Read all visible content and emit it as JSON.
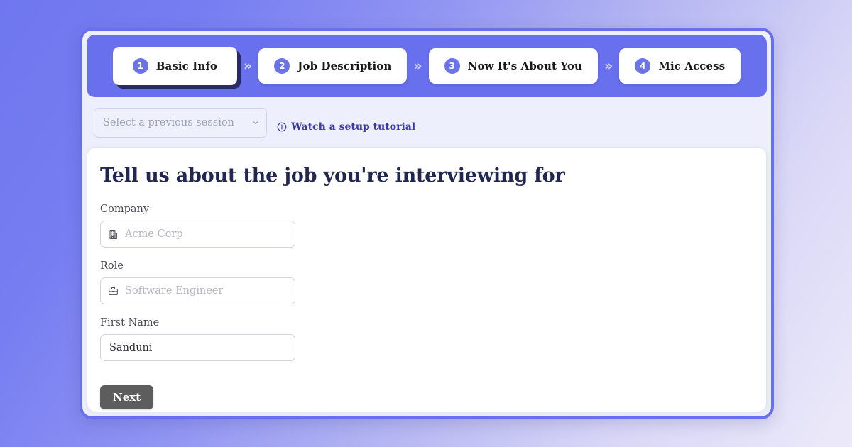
{
  "theme": {
    "accent": "#6870ee",
    "accent_circle": "#6b73e8",
    "title_color": "#222752",
    "link_color": "#3b3aa8",
    "button_color": "#5d5d5d",
    "card_bg": "#edf0fc"
  },
  "stepper": {
    "separator": "»",
    "steps": [
      {
        "number": "1",
        "label": "Basic Info",
        "active": true
      },
      {
        "number": "2",
        "label": "Job Description",
        "active": false
      },
      {
        "number": "3",
        "label": "Now It's About You",
        "active": false
      },
      {
        "number": "4",
        "label": "Mic Access",
        "active": false
      }
    ]
  },
  "session": {
    "select_placeholder": "Select a previous session",
    "select_value": "",
    "chevron_icon": "chevron-down-icon",
    "tutorial_link": "Watch a setup tutorial",
    "tutorial_icon": "info-circle-icon"
  },
  "form": {
    "title": "Tell us about the job you're interviewing for",
    "fields": [
      {
        "label": "Company",
        "placeholder": "Acme Corp",
        "value": "",
        "icon": "building-icon"
      },
      {
        "label": "Role",
        "placeholder": "Software Engineer",
        "value": "",
        "icon": "briefcase-icon"
      },
      {
        "label": "First Name",
        "placeholder": "",
        "value": "Sanduni",
        "icon": ""
      }
    ],
    "submit_label": "Next"
  }
}
